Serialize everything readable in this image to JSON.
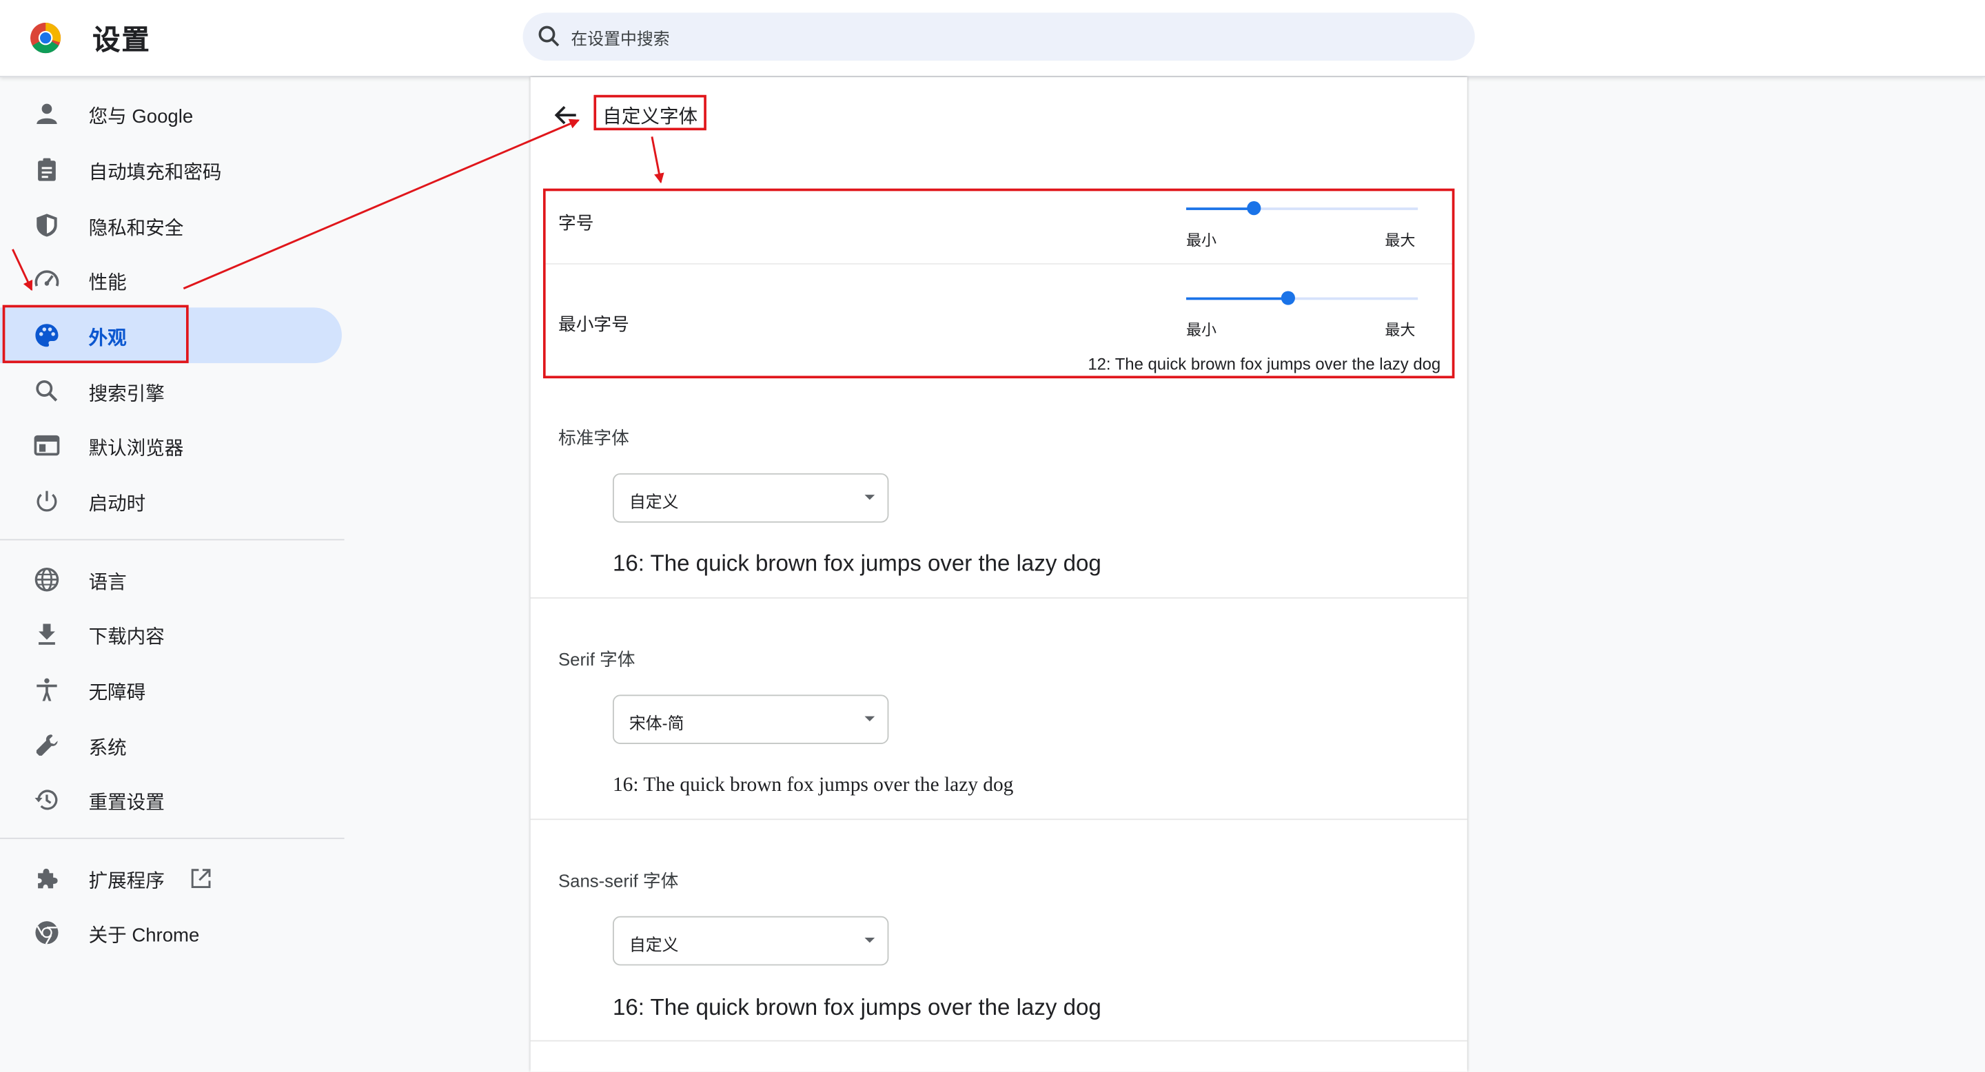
{
  "header": {
    "title": "设置",
    "search_placeholder": "在设置中搜索"
  },
  "sidebar": {
    "groups": [
      [
        {
          "label": "您与 Google",
          "icon": "person-icon"
        },
        {
          "label": "自动填充和密码",
          "icon": "clipboard-icon"
        },
        {
          "label": "隐私和安全",
          "icon": "shield-icon"
        },
        {
          "label": "性能",
          "icon": "speedometer-icon"
        },
        {
          "label": "外观",
          "icon": "palette-icon",
          "active": true
        },
        {
          "label": "搜索引擎",
          "icon": "search-icon"
        },
        {
          "label": "默认浏览器",
          "icon": "browser-window-icon"
        },
        {
          "label": "启动时",
          "icon": "power-icon"
        }
      ],
      [
        {
          "label": "语言",
          "icon": "globe-icon"
        },
        {
          "label": "下载内容",
          "icon": "download-icon"
        },
        {
          "label": "无障碍",
          "icon": "accessibility-icon"
        },
        {
          "label": "系统",
          "icon": "wrench-icon"
        },
        {
          "label": "重置设置",
          "icon": "history-icon"
        }
      ],
      [
        {
          "label": "扩展程序",
          "icon": "puzzle-icon",
          "external": true
        },
        {
          "label": "关于 Chrome",
          "icon": "chrome-icon"
        }
      ]
    ]
  },
  "page": {
    "title": "自定义字体",
    "font_size": {
      "label": "字号",
      "min_label": "最小",
      "max_label": "最大",
      "value_fraction": 0.29
    },
    "min_font_size": {
      "label": "最小字号",
      "min_label": "最小",
      "max_label": "最大",
      "value_fraction": 0.44,
      "preview": "12: The quick brown fox jumps over the lazy dog"
    },
    "fonts": [
      {
        "label": "标准字体",
        "selected": "自定义",
        "preview": "16: The quick brown fox jumps over the lazy dog"
      },
      {
        "label": "Serif 字体",
        "selected": "宋体-简",
        "preview": "16: The quick brown fox jumps over the lazy dog"
      },
      {
        "label": "Sans-serif 字体",
        "selected": "自定义",
        "preview": "16: The quick brown fox jumps over the lazy dog"
      }
    ]
  },
  "colors": {
    "accent": "#1a73e8",
    "active_bg": "#d3e3fd",
    "annotation": "#e0161b"
  }
}
